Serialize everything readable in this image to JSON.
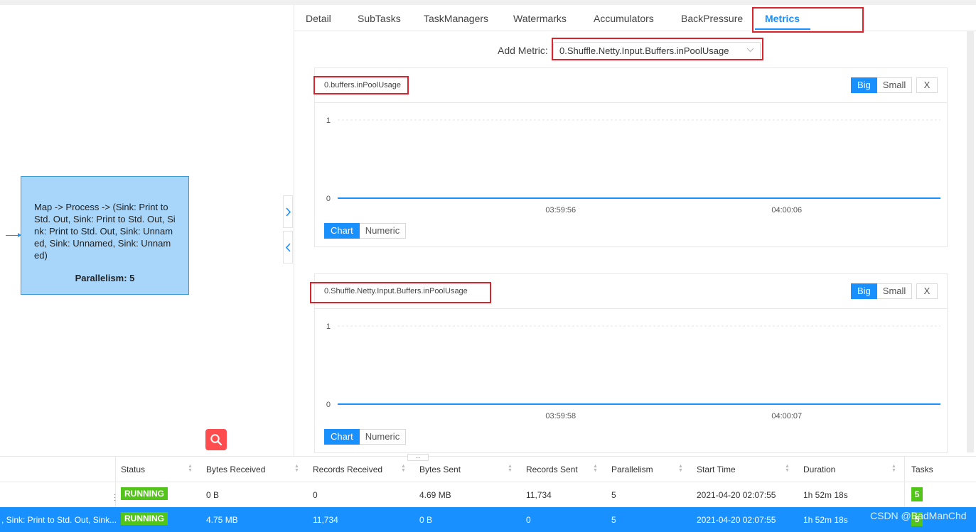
{
  "graph": {
    "node_name": "Map -> Process -> (Sink: Print to Std. Out, Sink: Print to Std. Out, Sink: Print to Std. Out, Sink: Unnamed, Sink: Unnamed, Sink: Unnamed)",
    "node_parallelism": "Parallelism: 5",
    "expand_icon": "chevron-right-icon",
    "collapse_icon": "chevron-left-icon",
    "zoom_icon": "search-icon"
  },
  "tabs": [
    "Detail",
    "SubTasks",
    "TaskManagers",
    "Watermarks",
    "Accumulators",
    "BackPressure",
    "Metrics"
  ],
  "active_tab": "Metrics",
  "add_metric": {
    "label": "Add Metric:",
    "selected": "0.Shuffle.Netty.Input.Buffers.inPoolUsage"
  },
  "metric_cards": [
    {
      "title": "0.buffers.inPoolUsage",
      "size_options": [
        "Big",
        "Small"
      ],
      "active_size": "Big",
      "close_label": "X",
      "view_options": [
        "Chart",
        "Numeric"
      ],
      "active_view": "Chart"
    },
    {
      "title": "0.Shuffle.Netty.Input.Buffers.inPoolUsage",
      "size_options": [
        "Big",
        "Small"
      ],
      "active_size": "Big",
      "close_label": "X",
      "view_options": [
        "Chart",
        "Numeric"
      ],
      "active_view": "Chart"
    }
  ],
  "chart_data": [
    {
      "type": "line",
      "title": "0.buffers.inPoolUsage",
      "x": [
        "03:59:56",
        "04:00:06"
      ],
      "x_ticks": [
        "03:59:56",
        "04:00:06"
      ],
      "y_ticks": [
        "1",
        "0"
      ],
      "ylim": [
        0,
        1
      ],
      "series": [
        {
          "values": [
            0,
            0
          ]
        }
      ],
      "color": "#1890ff",
      "grid": true
    },
    {
      "type": "line",
      "title": "0.Shuffle.Netty.Input.Buffers.inPoolUsage",
      "x": [
        "03:59:58",
        "04:00:07"
      ],
      "x_ticks": [
        "03:59:58",
        "04:00:07"
      ],
      "y_ticks": [
        "1",
        "0"
      ],
      "ylim": [
        0,
        1
      ],
      "series": [
        {
          "values": [
            0,
            0
          ]
        }
      ],
      "color": "#1890ff",
      "grid": true
    }
  ],
  "table": {
    "columns": [
      "Status",
      "Bytes Received",
      "Records Received",
      "Bytes Sent",
      "Records Sent",
      "Parallelism",
      "Start Time",
      "Duration",
      "Tasks"
    ],
    "rows": [
      {
        "name": "",
        "status": "RUNNING",
        "bytes_received": "0 B",
        "records_received": "0",
        "bytes_sent": "4.69 MB",
        "records_sent": "11,734",
        "parallelism": "5",
        "start_time": "2021-04-20 02:07:55",
        "duration": "1h 52m 18s",
        "tasks": "5"
      },
      {
        "name": ", Sink: Print to Std. Out, Sink...",
        "status": "RUNNING",
        "bytes_received": "4.75 MB",
        "records_received": "11,734",
        "bytes_sent": "0 B",
        "records_sent": "0",
        "parallelism": "5",
        "start_time": "2021-04-20 02:07:55",
        "duration": "1h 52m 18s",
        "tasks": "5"
      }
    ]
  },
  "watermark": "CSDN @BadManChd",
  "colors": {
    "accent": "#1890ff",
    "running": "#52c41a",
    "highlight": "#d9232d",
    "node_fill": "#a8d6fb"
  }
}
